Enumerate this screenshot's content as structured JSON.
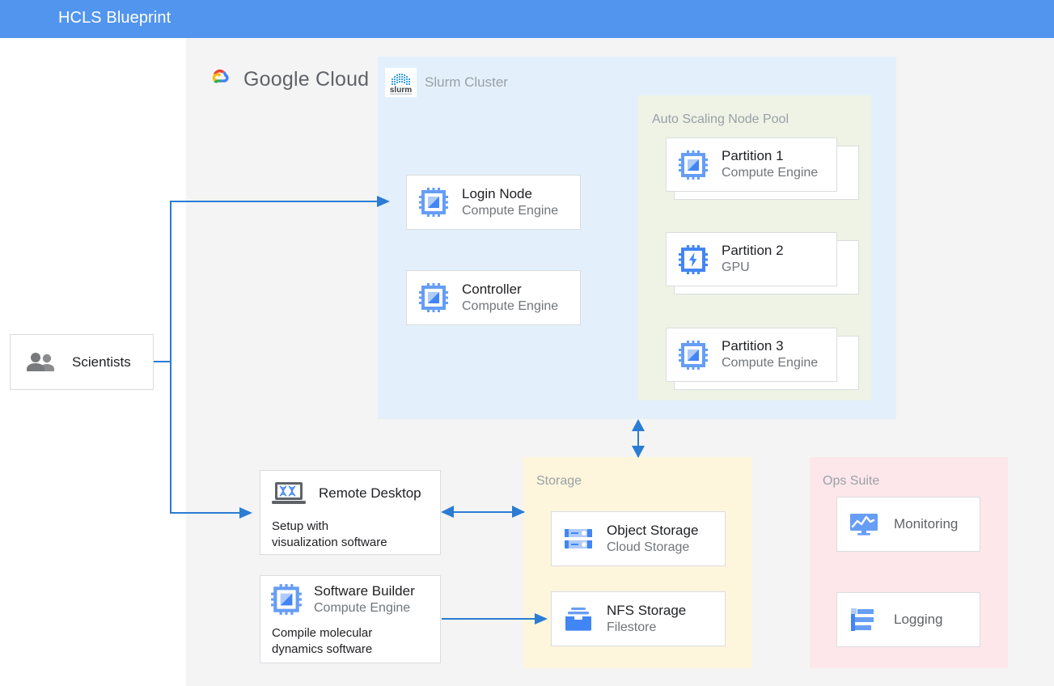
{
  "header": {
    "title": "HCLS Blueprint",
    "bar_color": "#5295ee"
  },
  "cloud": {
    "provider_label": "Google Cloud",
    "provider_logo_icon": "google-cloud-logo-icon",
    "panel_color": "#f4f4f4"
  },
  "slurm": {
    "label": "Slurm Cluster",
    "logo_icon": "slurm-logo-icon",
    "panel_color": "#e3f0fb",
    "nodes": [
      {
        "title": "Login Node",
        "subtitle": "Compute Engine",
        "icon": "compute-engine-icon"
      },
      {
        "title": "Controller",
        "subtitle": "Compute Engine",
        "icon": "compute-engine-icon"
      }
    ]
  },
  "node_pool": {
    "label": "Auto Scaling Node Pool",
    "panel_color": "#eef3e6",
    "partitions": [
      {
        "title": "Partition 1",
        "subtitle": "Compute Engine",
        "icon": "compute-engine-icon"
      },
      {
        "title": "Partition 2",
        "subtitle": "GPU",
        "icon": "gpu-icon"
      },
      {
        "title": "Partition 3",
        "subtitle": "Compute Engine",
        "icon": "compute-engine-icon"
      }
    ]
  },
  "users": {
    "title": "Scientists",
    "icon": "people-icon"
  },
  "workstations": [
    {
      "title": "Remote Desktop",
      "icon": "laptop-dna-icon",
      "note": "Setup with\nvisualization software",
      "note_line1": "Setup with",
      "note_line2": "visualization software"
    },
    {
      "title": "Software Builder",
      "subtitle": "Compute Engine",
      "icon": "compute-engine-icon",
      "note_line1": "Compile molecular",
      "note_line2": "dynamics software"
    }
  ],
  "storage": {
    "label": "Storage",
    "panel_color": "#fdf6dd",
    "items": [
      {
        "title": "Object Storage",
        "subtitle": "Cloud Storage",
        "icon": "cloud-storage-icon"
      },
      {
        "title": "NFS Storage",
        "subtitle": "Filestore",
        "icon": "filestore-icon"
      }
    ]
  },
  "ops_suite": {
    "label": "Ops Suite",
    "panel_color": "#fde7ea",
    "items": [
      {
        "title": "Monitoring",
        "icon": "monitoring-icon"
      },
      {
        "title": "Logging",
        "icon": "logging-icon"
      }
    ]
  },
  "connectors": {
    "line_color": "#2b7cd3",
    "edges": [
      {
        "from": "Scientists",
        "to": "Login Node",
        "type": "single"
      },
      {
        "from": "Scientists",
        "to": "Remote Desktop",
        "type": "single"
      },
      {
        "from": "Slurm Cluster",
        "to": "Storage",
        "type": "double"
      },
      {
        "from": "Remote Desktop",
        "to": "Storage",
        "type": "double"
      },
      {
        "from": "Software Builder",
        "to": "NFS Storage",
        "type": "single"
      }
    ]
  }
}
